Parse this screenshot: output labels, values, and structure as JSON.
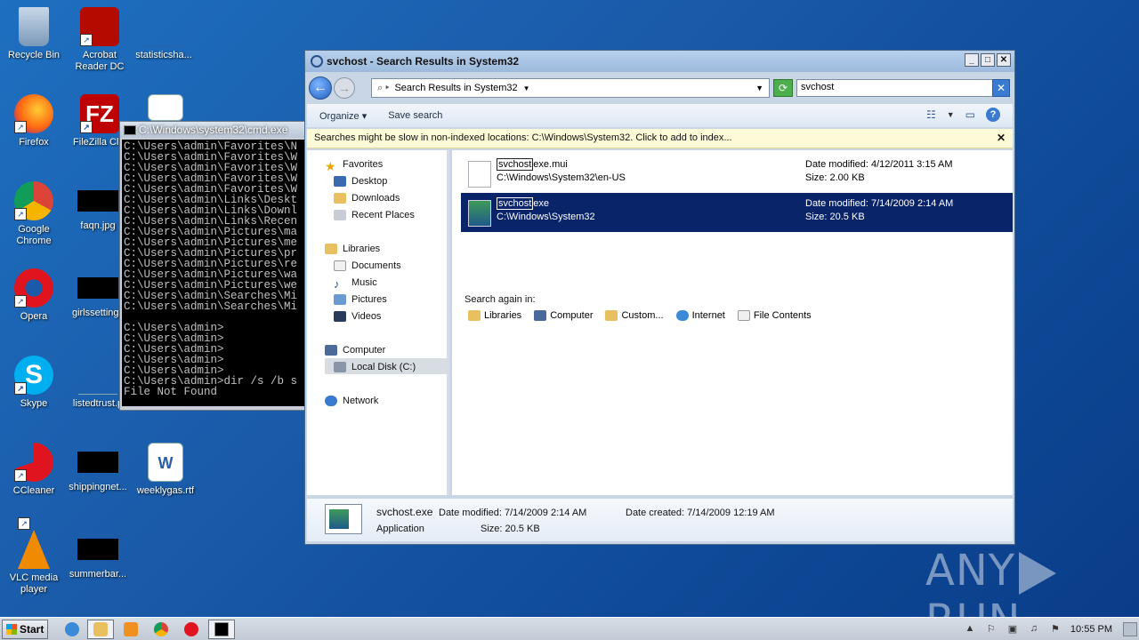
{
  "desktop": {
    "icons": [
      {
        "label": "Recycle Bin"
      },
      {
        "label": "Acrobat Reader DC"
      },
      {
        "label": "statisticsha..."
      },
      {
        "label": "Firefox"
      },
      {
        "label": "FileZilla Clie"
      },
      {
        "label": "Google Chrome"
      },
      {
        "label": "faqn.jpg"
      },
      {
        "label": "Opera"
      },
      {
        "label": "girlssettings"
      },
      {
        "label": "Skype"
      },
      {
        "label": "listedtrust.p"
      },
      {
        "label": "CCleaner"
      },
      {
        "label": "shippingnet..."
      },
      {
        "label": "weeklygas.rtf"
      },
      {
        "label": "VLC media player"
      },
      {
        "label": "summerbar..."
      }
    ]
  },
  "cmd": {
    "title": "C:\\Windows\\system32\\cmd.exe",
    "lines": "C:\\Users\\admin\\Favorites\\N\nC:\\Users\\admin\\Favorites\\W\nC:\\Users\\admin\\Favorites\\W\nC:\\Users\\admin\\Favorites\\W\nC:\\Users\\admin\\Favorites\\W\nC:\\Users\\admin\\Links\\Deskt\nC:\\Users\\admin\\Links\\Downl\nC:\\Users\\admin\\Links\\Recen\nC:\\Users\\admin\\Pictures\\ma\nC:\\Users\\admin\\Pictures\\me\nC:\\Users\\admin\\Pictures\\pr\nC:\\Users\\admin\\Pictures\\re\nC:\\Users\\admin\\Pictures\\wa\nC:\\Users\\admin\\Pictures\\we\nC:\\Users\\admin\\Searches\\Mi\nC:\\Users\\admin\\Searches\\Mi\n\nC:\\Users\\admin>\nC:\\Users\\admin>\nC:\\Users\\admin>\nC:\\Users\\admin>\nC:\\Users\\admin>\nC:\\Users\\admin>dir /s /b s\nFile Not Found\n\nC:\\Users\\admin>"
  },
  "explorer": {
    "title": "svchost - Search Results in System32",
    "address": "Search Results in System32",
    "search_value": "svchost",
    "toolbar": {
      "organize": "Organize",
      "save_search": "Save search"
    },
    "infobar": "Searches might be slow in non-indexed locations: C:\\Windows\\System32. Click to add to index...",
    "nav": {
      "favorites": "Favorites",
      "desktop": "Desktop",
      "downloads": "Downloads",
      "recent_places": "Recent Places",
      "libraries": "Libraries",
      "documents": "Documents",
      "music": "Music",
      "pictures": "Pictures",
      "videos": "Videos",
      "computer": "Computer",
      "local_disk": "Local Disk (C:)",
      "network": "Network"
    },
    "files": [
      {
        "name_hl": "svchost",
        "name_rest": "exe.mui",
        "path": "C:\\Windows\\System32\\en-US",
        "date": "Date modified: 4/12/2011 3:15 AM",
        "size": "Size: 2.00 KB"
      },
      {
        "name_hl": "svchost",
        "name_rest": "exe",
        "path": "C:\\Windows\\System32",
        "date": "Date modified: 7/14/2009 2:14 AM",
        "size": "Size: 20.5 KB"
      }
    ],
    "search_again_label": "Search again in:",
    "search_again": [
      "Libraries",
      "Computer",
      "Custom...",
      "Internet",
      "File Contents"
    ],
    "details": {
      "name": "svchost.exe",
      "date_modified": "Date modified:  7/14/2009 2:14 AM",
      "date_created": "Date created:  7/14/2009 12:19 AM",
      "type": "Application",
      "size": "Size:  20.5 KB"
    }
  },
  "taskbar": {
    "start_label": "Start",
    "clock": "10:55 PM"
  },
  "watermark": {
    "left": "ANY",
    "right": "RUN"
  }
}
